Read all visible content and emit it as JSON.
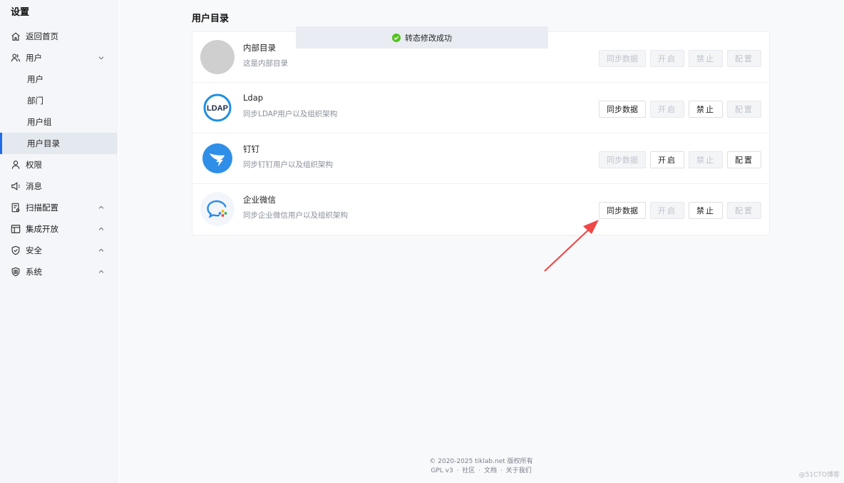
{
  "sidebar": {
    "title": "设置",
    "items": [
      {
        "label": "返回首页",
        "icon": "home-icon"
      },
      {
        "label": "用户",
        "icon": "users-icon",
        "expanded": true
      },
      {
        "label": "用户"
      },
      {
        "label": "部门"
      },
      {
        "label": "用户组"
      },
      {
        "label": "用户目录",
        "active": true
      },
      {
        "label": "权限",
        "icon": "person-icon"
      },
      {
        "label": "消息",
        "icon": "megaphone-icon"
      },
      {
        "label": "扫描配置",
        "icon": "scan-config-icon",
        "expanded": false
      },
      {
        "label": "集成开放",
        "icon": "layout-icon",
        "expanded": false
      },
      {
        "label": "安全",
        "icon": "shield-icon",
        "expanded": false
      },
      {
        "label": "系统",
        "icon": "system-icon",
        "expanded": false
      }
    ]
  },
  "main": {
    "title": "用户目录",
    "directories": [
      {
        "name": "内部目录",
        "desc": "这是内部目录",
        "logo": "default-avatar",
        "buttons": {
          "sync": "同步数据",
          "enable": "开启",
          "disable": "禁止",
          "config": "配置"
        },
        "state": {
          "sync": "disabled",
          "enable": "disabled",
          "disable": "disabled",
          "config": "disabled"
        }
      },
      {
        "name": "Ldap",
        "desc": "同步LDAP用户以及组织架构",
        "logo": "ldap-logo",
        "logo_text": "LDAP",
        "buttons": {
          "sync": "同步数据",
          "enable": "开启",
          "disable": "禁止",
          "config": "配置"
        },
        "state": {
          "sync": "enabled",
          "enable": "disabled",
          "disable": "enabled",
          "config": "disabled"
        }
      },
      {
        "name": "钉钉",
        "desc": "同步钉钉用户以及组织架构",
        "logo": "dingtalk-logo",
        "buttons": {
          "sync": "同步数据",
          "enable": "开启",
          "disable": "禁止",
          "config": "配置"
        },
        "state": {
          "sync": "disabled",
          "enable": "enabled",
          "disable": "disabled",
          "config": "enabled"
        }
      },
      {
        "name": "企业微信",
        "desc": "同步企业微信用户以及组织架构",
        "logo": "wecom-logo",
        "buttons": {
          "sync": "同步数据",
          "enable": "开启",
          "disable": "禁止",
          "config": "配置"
        },
        "state": {
          "sync": "enabled",
          "enable": "disabled",
          "disable": "enabled",
          "config": "disabled"
        }
      }
    ]
  },
  "toast": {
    "message": "转态修改成功",
    "icon": "check-circle-icon"
  },
  "footer": {
    "copyright": "© 2020-2025 tiklab.net 版权所有",
    "links": [
      "GPL v3",
      "社区",
      "文档",
      "关于我们"
    ],
    "separator": "·"
  },
  "watermark": "@51CTO博客",
  "colors": {
    "accent": "#1f6de8",
    "sidebar_bg": "#f4f6f9",
    "main_bg": "#f8f9fb",
    "success": "#52c41a",
    "arrow": "#f04747"
  }
}
